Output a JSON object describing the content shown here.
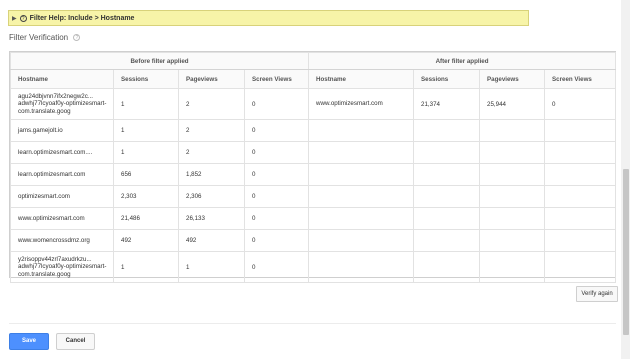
{
  "help": {
    "text": "Filter Help: Include  >  Hostname"
  },
  "section": {
    "title": "Filter Verification"
  },
  "table": {
    "group_before": "Before filter applied",
    "group_after": "After filter applied",
    "headers": [
      "Hostname",
      "Sessions",
      "Pageviews",
      "Screen Views",
      "Hostname",
      "Sessions",
      "Pageviews",
      "Screen Views"
    ],
    "rows": [
      {
        "b_host": "agu24dbjvnn7ifx2negw2c... adwhj77lcyoaf0y-optimizesmart-com.translate.goog",
        "b_sessions": "1",
        "b_pageviews": "2",
        "b_screen": "0",
        "a_host": "www.optimizesmart.com",
        "a_sessions": "21,374",
        "a_pageviews": "25,944",
        "a_screen": "0"
      },
      {
        "b_host": "jams.gamejolt.io",
        "b_sessions": "1",
        "b_pageviews": "2",
        "b_screen": "0",
        "a_host": "",
        "a_sessions": "",
        "a_pageviews": "",
        "a_screen": ""
      },
      {
        "b_host": "learn.optimizesmart.com....",
        "b_sessions": "1",
        "b_pageviews": "2",
        "b_screen": "0",
        "a_host": "",
        "a_sessions": "",
        "a_pageviews": "",
        "a_screen": ""
      },
      {
        "b_host": "learn.optimizesmart.com",
        "b_sessions": "656",
        "b_pageviews": "1,852",
        "b_screen": "0",
        "a_host": "",
        "a_sessions": "",
        "a_pageviews": "",
        "a_screen": ""
      },
      {
        "b_host": "optimizesmart.com",
        "b_sessions": "2,303",
        "b_pageviews": "2,306",
        "b_screen": "0",
        "a_host": "",
        "a_sessions": "",
        "a_pageviews": "",
        "a_screen": ""
      },
      {
        "b_host": "www.optimizesmart.com",
        "b_sessions": "21,486",
        "b_pageviews": "26,133",
        "b_screen": "0",
        "a_host": "",
        "a_sessions": "",
        "a_pageviews": "",
        "a_screen": ""
      },
      {
        "b_host": "www.womencrossdmz.org",
        "b_sessions": "492",
        "b_pageviews": "492",
        "b_screen": "0",
        "a_host": "",
        "a_sessions": "",
        "a_pageviews": "",
        "a_screen": ""
      },
      {
        "b_host": "y2risoppv44zrl7axudrkzu... adwhj77lcyoaf0y-optimizesmart-com.translate.goog",
        "b_sessions": "1",
        "b_pageviews": "1",
        "b_screen": "0",
        "a_host": "",
        "a_sessions": "",
        "a_pageviews": "",
        "a_screen": ""
      }
    ]
  },
  "buttons": {
    "verify": "Verify again",
    "save": "Save",
    "cancel": "Cancel"
  }
}
